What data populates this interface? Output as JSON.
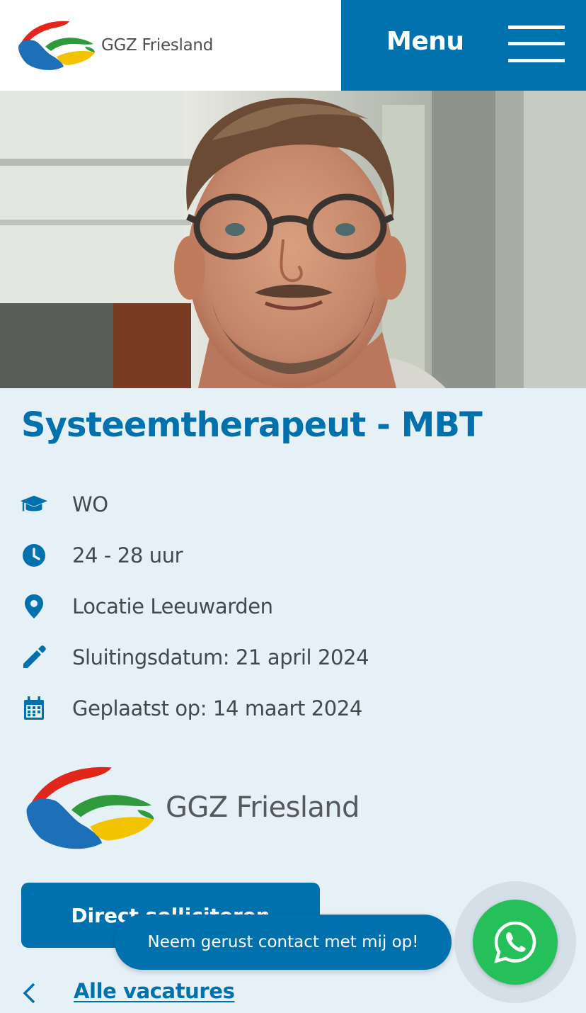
{
  "header": {
    "brand_name": "GGZ Friesland",
    "menu_label": "Menu"
  },
  "hero": {
    "image": "portrait-photo"
  },
  "job": {
    "title": "Systeemtherapeut - MBT",
    "meta": [
      {
        "icon": "graduation-cap-icon",
        "text": "WO"
      },
      {
        "icon": "clock-icon",
        "text": "24 - 28 uur"
      },
      {
        "icon": "location-pin-icon",
        "text": "Locatie Leeuwarden"
      },
      {
        "icon": "pencil-icon",
        "text": "Sluitingsdatum: 21 april 2024"
      },
      {
        "icon": "calendar-icon",
        "text": "Geplaatst op: 14 maart 2024"
      }
    ],
    "company_name": "GGZ Friesland",
    "apply_label": "Direct solliciteren",
    "back_label": "Alle vacatures"
  },
  "chat": {
    "bubble_text": "Neem gerust contact met mij op!",
    "button_icon": "whatsapp-icon"
  },
  "colors": {
    "primary_blue": "#0071ad",
    "background": "#e5f0f7",
    "whatsapp_green": "#25c05a",
    "logo_red": "#e3261c",
    "logo_green": "#2f9a3b",
    "logo_yellow": "#f2c400",
    "logo_blue": "#1d6fb8"
  }
}
